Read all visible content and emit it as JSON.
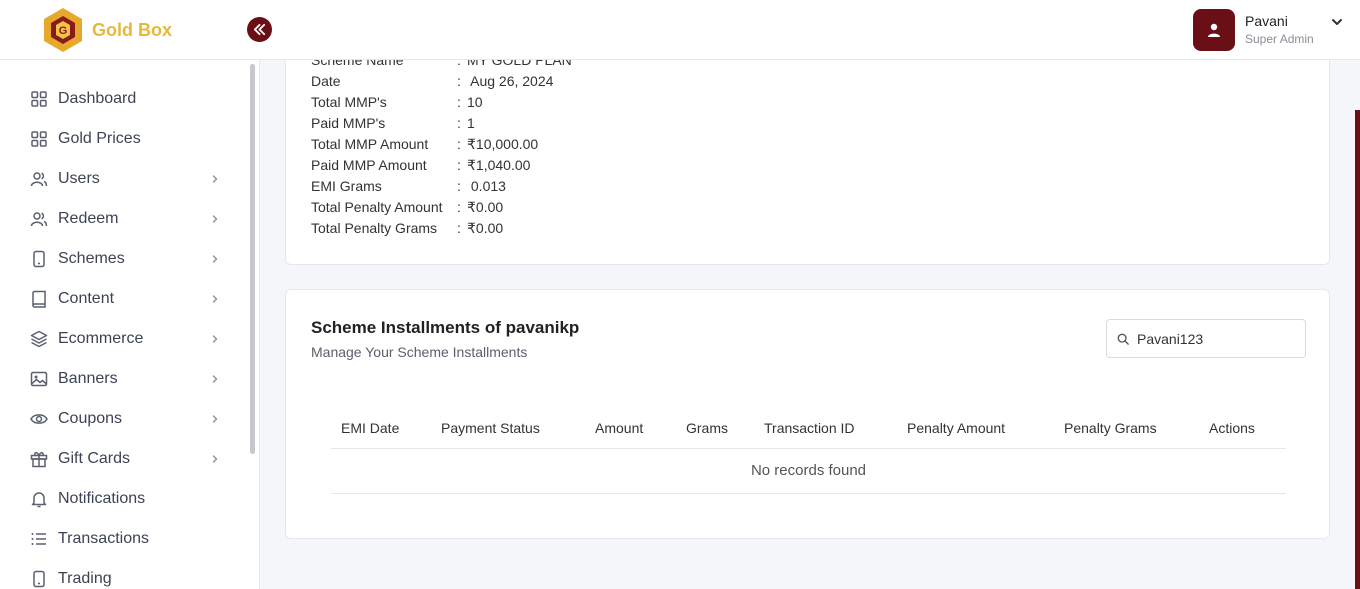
{
  "brand": {
    "name": "Gold Box"
  },
  "user": {
    "name": "Pavani",
    "role": "Super Admin"
  },
  "sidebar": {
    "items": [
      {
        "label": "Dashboard",
        "icon": "grid-icon",
        "has_children": false
      },
      {
        "label": "Gold Prices",
        "icon": "grid-icon",
        "has_children": false
      },
      {
        "label": "Users",
        "icon": "users-icon",
        "has_children": true
      },
      {
        "label": "Redeem",
        "icon": "users-icon",
        "has_children": true
      },
      {
        "label": "Schemes",
        "icon": "phone-icon",
        "has_children": true
      },
      {
        "label": "Content",
        "icon": "book-icon",
        "has_children": true
      },
      {
        "label": "Ecommerce",
        "icon": "layers-icon",
        "has_children": true
      },
      {
        "label": "Banners",
        "icon": "image-icon",
        "has_children": true
      },
      {
        "label": "Coupons",
        "icon": "eye-icon",
        "has_children": true
      },
      {
        "label": "Gift Cards",
        "icon": "gift-icon",
        "has_children": true
      },
      {
        "label": "Notifications",
        "icon": "bell-icon",
        "has_children": false
      },
      {
        "label": "Transactions",
        "icon": "list-icon",
        "has_children": false
      },
      {
        "label": "Trading",
        "icon": "phone-icon",
        "has_children": false
      }
    ]
  },
  "details": {
    "rows": [
      {
        "key": "Scheme Name",
        "value": "MY GOLD PLAN"
      },
      {
        "key": "Date",
        "value": " Aug 26, 2024"
      },
      {
        "key": "Total MMP's",
        "value": "10"
      },
      {
        "key": "Paid MMP's",
        "value": "1"
      },
      {
        "key": "Total MMP Amount",
        "value": "₹10,000.00"
      },
      {
        "key": "Paid MMP Amount",
        "value": "₹1,040.00"
      },
      {
        "key": "EMI Grams",
        "value": " 0.013"
      },
      {
        "key": "Total Penalty Amount",
        "value": "₹0.00"
      },
      {
        "key": "Total Penalty Grams",
        "value": "₹0.00"
      }
    ]
  },
  "installments": {
    "title": "Scheme Installments of pavanikp",
    "subtitle": "Manage Your Scheme Installments",
    "search_value": "Pavani123",
    "columns": [
      "EMI Date",
      "Payment Status",
      "Amount",
      "Grams",
      "Transaction ID",
      "Penalty Amount",
      "Penalty Grams",
      "Actions"
    ],
    "empty_text": "No records found"
  },
  "colors": {
    "accent": "#6b0f16",
    "brand_gold": "#e6b93b"
  }
}
